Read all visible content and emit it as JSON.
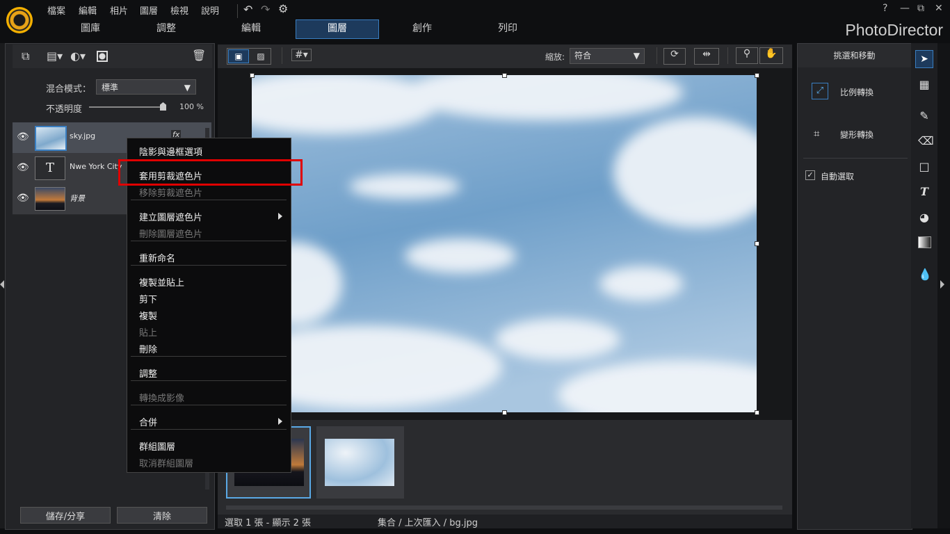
{
  "app": {
    "brand": "PhotoDirector"
  },
  "menu": [
    "檔案",
    "編輯",
    "相片",
    "圖層",
    "檢視",
    "說明"
  ],
  "nav_tabs": [
    "圖庫",
    "調整",
    "編輯",
    "圖層",
    "創作",
    "列印"
  ],
  "active_tab": "圖層",
  "window": {
    "help": "?",
    "minimize": "—",
    "restore": "⧉",
    "close": "✕"
  },
  "layer_panel": {
    "blend_label": "混合模式：",
    "blend_value": "標準",
    "opacity_label": "不透明度",
    "opacity_value": "100 %",
    "opacity_fraction": 1.0,
    "layers": [
      {
        "name": "sky.jpg",
        "fx": "fx"
      },
      {
        "name": "Nwe York City",
        "type_glyph": "T"
      },
      {
        "name": "背景"
      }
    ],
    "save_share": "儲存/分享",
    "clear": "清除"
  },
  "canvas_toolbar": {
    "zoom_label": "縮放:",
    "zoom_value": "符合"
  },
  "status": {
    "selection": "選取 1 張 - 顯示 2 張",
    "path": "集合 / 上次匯入 / bg.jpg"
  },
  "right_panel": {
    "title": "挑選和移動",
    "scale": "比例轉換",
    "transform": "變形轉換",
    "auto_select": "自動選取"
  },
  "context_menu": {
    "items": [
      {
        "label": "陰影與邊框選項",
        "enabled": true
      },
      {
        "label": "套用剪裁遮色片",
        "enabled": true
      },
      {
        "label": "移除剪裁遮色片",
        "enabled": false
      },
      {
        "label": "建立圖層遮色片",
        "enabled": true,
        "submenu": true
      },
      {
        "label": "刪除圖層遮色片",
        "enabled": false
      },
      {
        "label": "重新命名",
        "enabled": true
      },
      {
        "label": "複製並貼上",
        "enabled": true
      },
      {
        "label": "剪下",
        "enabled": true
      },
      {
        "label": "複製",
        "enabled": true
      },
      {
        "label": "貼上",
        "enabled": false
      },
      {
        "label": "刪除",
        "enabled": true
      },
      {
        "label": "調整",
        "enabled": true
      },
      {
        "label": "轉換成影像",
        "enabled": false
      },
      {
        "label": "合併",
        "enabled": true,
        "submenu": true
      },
      {
        "label": "群組圖層",
        "enabled": true
      },
      {
        "label": "取消群組圖層",
        "enabled": false
      }
    ]
  },
  "colors": {
    "accent": "#3a7fc2",
    "highlight_box": "#e00000"
  }
}
